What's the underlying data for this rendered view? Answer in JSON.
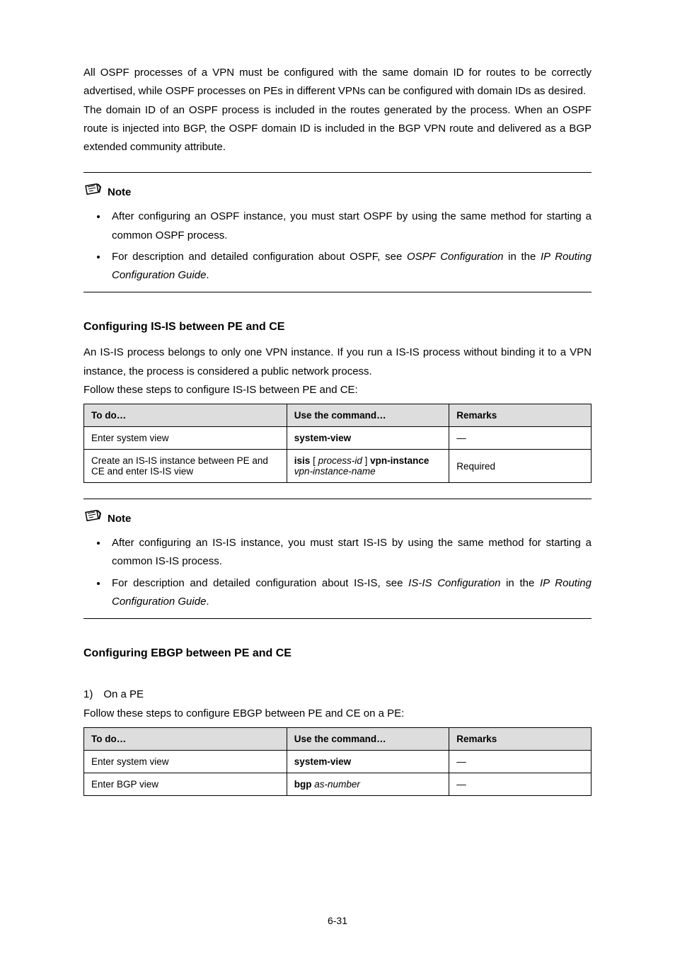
{
  "para1": "All OSPF processes of a VPN must be configured with the same domain ID for routes to be correctly advertised, while OSPF processes on PEs in different VPNs can be configured with domain IDs as desired.",
  "para2": "The domain ID of an OSPF process is included in the routes generated by the process. When an OSPF route is injected into BGP, the OSPF domain ID is included in the BGP VPN route and delivered as a BGP extended community attribute.",
  "note_label": "Note",
  "note1": {
    "b1": "After configuring an OSPF instance, you must start OSPF by using the same method for starting a common OSPF process.",
    "b2_pre": "For description and detailed configuration about OSPF, see ",
    "b2_link": "OSPF Configuration",
    "b2_mid": " in the ",
    "b2_link2": "IP Routing Configuration Guide",
    "b2_end": "."
  },
  "h3_isis": "Configuring IS-IS between PE and CE",
  "isis_p1": "An IS-IS process belongs to only one VPN instance. If you run a IS-IS process without binding it to a VPN instance, the process is considered a public network process.",
  "isis_p2": "Follow these steps to configure IS-IS between PE and CE:",
  "headers": {
    "c1": "To do…",
    "c2": "Use the command…",
    "c3": "Remarks"
  },
  "t1": {
    "r1": {
      "c1": "Enter system view",
      "c2": "system-view",
      "c3": "—"
    },
    "r2": {
      "c1": "Create an IS-IS instance between PE and CE and enter IS-IS view",
      "c2_a": "isis",
      "c2_b": " [ ",
      "c2_c": "process-id",
      "c2_d": " ] ",
      "c2_e": "vpn-instance",
      "c2_f": " vpn-instance-name",
      "c3": "Required"
    }
  },
  "note2": {
    "b1": "After configuring an IS-IS instance, you must start IS-IS by using the same method for starting a common IS-IS process.",
    "b2_pre": "For description and detailed configuration about IS-IS, see ",
    "b2_link": "IS-IS Configuration",
    "b2_mid": " in the ",
    "b2_link2": "IP Routing Configuration Guide",
    "b2_end": "."
  },
  "h3_ebgp": "Configuring EBGP between PE and CE",
  "ebgp_step": "1) On a PE",
  "ebgp_p1": "Follow these steps to configure EBGP between PE and CE on a PE:",
  "t2": {
    "r1": {
      "c1": "Enter system view",
      "c2": "system-view",
      "c3": "—"
    },
    "r2": {
      "c1": "Enter BGP view",
      "c2_a": "bgp",
      "c2_b": " as-number",
      "c3": "—"
    }
  },
  "page_number": "6-31"
}
